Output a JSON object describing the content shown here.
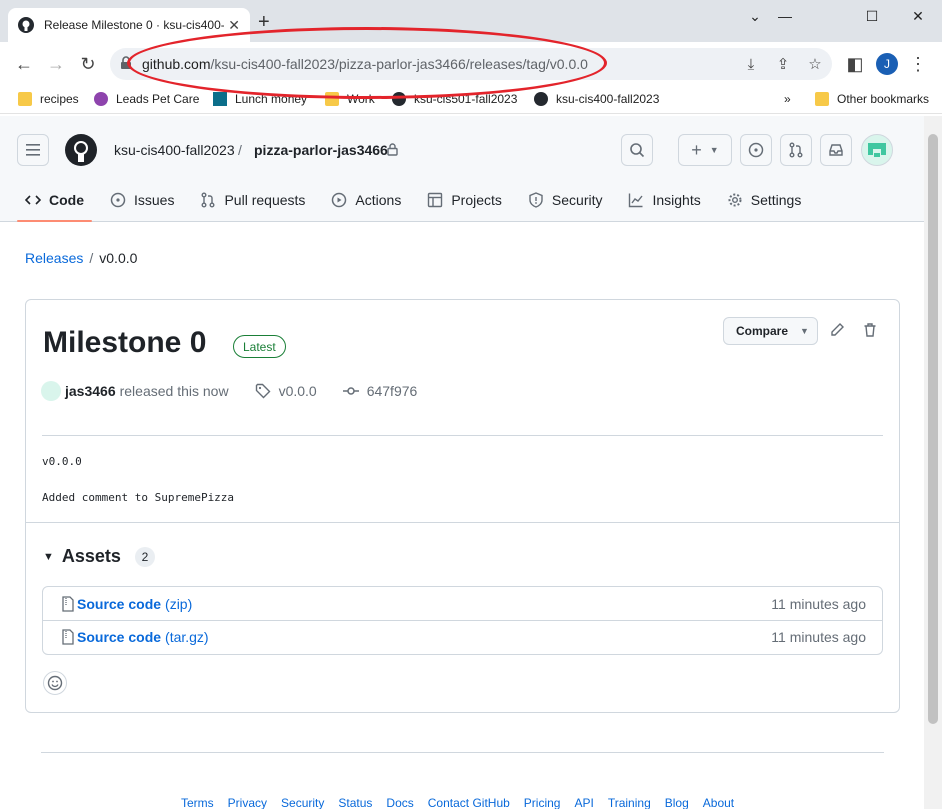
{
  "browser": {
    "tab_title": "Release Milestone 0 · ksu-cis400-",
    "url_host": "github.com",
    "url_path": "/ksu-cis400-fall2023/pizza-parlor-jas3466/releases/tag/v0.0.0",
    "profile_initial": "J",
    "bookmarks": [
      "recipes",
      "Leads Pet Care",
      "Lunch money",
      "Work",
      "ksu-cis501-fall2023",
      "ksu-cis400-fall2023"
    ],
    "overflow": "»",
    "other_bookmarks": "Other bookmarks"
  },
  "header": {
    "org": "ksu-cis400-fall2023",
    "separator": "/",
    "repo": "pizza-parlor-jas3466"
  },
  "repo_tabs": [
    "Code",
    "Issues",
    "Pull requests",
    "Actions",
    "Projects",
    "Security",
    "Insights",
    "Settings"
  ],
  "breadcrumb": {
    "releases": "Releases",
    "separator": "/",
    "current": "v0.0.0"
  },
  "release": {
    "title": "Milestone 0",
    "badge": "Latest",
    "compare_label": "Compare",
    "user": "jas3466",
    "action_text": "released this now",
    "tag": "v0.0.0",
    "commit": "647f976",
    "body_line1": "v0.0.0",
    "body_line2": "Added comment to SupremePizza"
  },
  "assets": {
    "heading": "Assets",
    "count": "2",
    "items": [
      {
        "name": "Source code",
        "ext": "(zip)",
        "time": "11 minutes ago"
      },
      {
        "name": "Source code",
        "ext": "(tar.gz)",
        "time": "11 minutes ago"
      }
    ]
  },
  "footer_links": [
    "Terms",
    "Privacy",
    "Security",
    "Status",
    "Docs",
    "Contact GitHub",
    "Pricing",
    "API",
    "Training",
    "Blog",
    "About"
  ],
  "colors": {
    "accent": "#0969da",
    "latest_green": "#1a7f37",
    "annotation_red": "#e3242b",
    "active_tab_underline": "#fd8c73"
  }
}
